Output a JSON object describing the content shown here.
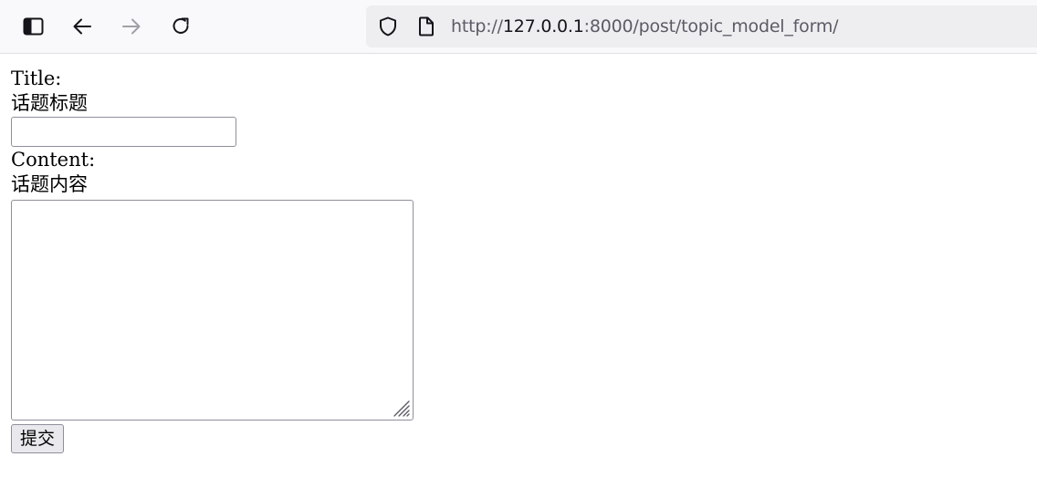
{
  "browser": {
    "url_scheme": "http://",
    "url_host": "127.0.0.1",
    "url_rest": ":8000/post/topic_model_form/",
    "icons": {
      "sidebar": "sidebar-icon",
      "back": "back-arrow-icon",
      "forward": "forward-arrow-icon",
      "reload": "reload-icon",
      "shield": "shield-icon",
      "page": "page-icon"
    }
  },
  "form": {
    "title_label": "Title:",
    "title_help": "话题标题",
    "title_value": "",
    "content_label": "Content:",
    "content_help": "话题内容",
    "content_value": "",
    "submit_label": "提交"
  },
  "colors": {
    "toolbar_bg": "#f9f9fb",
    "url_bar_bg": "#eeeef1",
    "button_bg": "#e9e9ed",
    "border": "#8f8f9d",
    "disabled_icon": "#a0a0a8"
  }
}
